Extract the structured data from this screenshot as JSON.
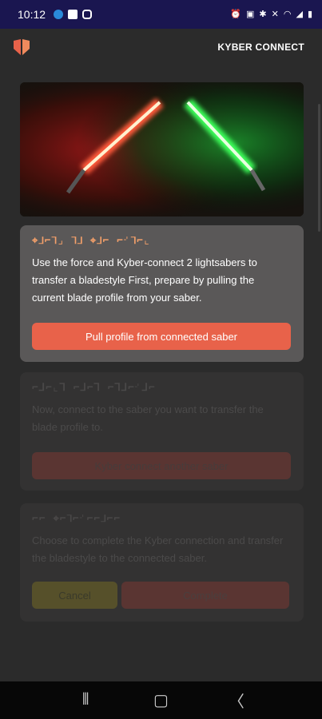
{
  "status_bar": {
    "time": "10:12",
    "left_icons": [
      "skype-icon",
      "photo-icon",
      "instagram-icon"
    ],
    "right_icons": [
      "alarm-icon",
      "nfc-icon",
      "bluetooth-icon",
      "mute-icon",
      "wifi-icon",
      "signal-icon",
      "battery-icon"
    ]
  },
  "app_bar": {
    "logo_icon": "kyber-logo-icon",
    "title": "KYBER CONNECT"
  },
  "hero": {
    "image": "crossed-lightsabers-red-green-image"
  },
  "steps": [
    {
      "aurebesh_title": "⌖⅃⌐⅂⌟ ⅂⅃ ⌖⅃⌐ ⌐⌏⅂⌐⌞",
      "description": "Use the force and Kyber-connect 2 lightsabers to transfer a bladestyle First, prepare by pulling the current blade profile from your saber.",
      "button_label": "Pull profile from connected saber",
      "active": true
    },
    {
      "aurebesh_title": "⌐⅃⌐⌞⅂ ⌐⅃⌐⅂ ⌐⅂⅃⌐⌏⅃⌐",
      "description": "Now, connect to the saber you want to transfer the blade profile to.",
      "button_label": "Kyber connect another saber",
      "active": false
    },
    {
      "aurebesh_title": "⌐⌐ ⌖⌐⅂⌐⌏⌐⌐⅃⌐⌐",
      "description": "Choose to complete the Kyber connection and transfer the bladestyle to the connected saber.",
      "cancel_label": "Cancel",
      "complete_label": "Complete",
      "active": false
    }
  ],
  "nav_bar": {
    "recents_icon": "recents-icon",
    "home_icon": "home-icon",
    "back_icon": "back-icon"
  },
  "colors": {
    "status_bar": "#1a1650",
    "background": "#2b2b2b",
    "accent": "#e8624a",
    "active_card": "#5a5858",
    "inactive_card": "#333232"
  }
}
